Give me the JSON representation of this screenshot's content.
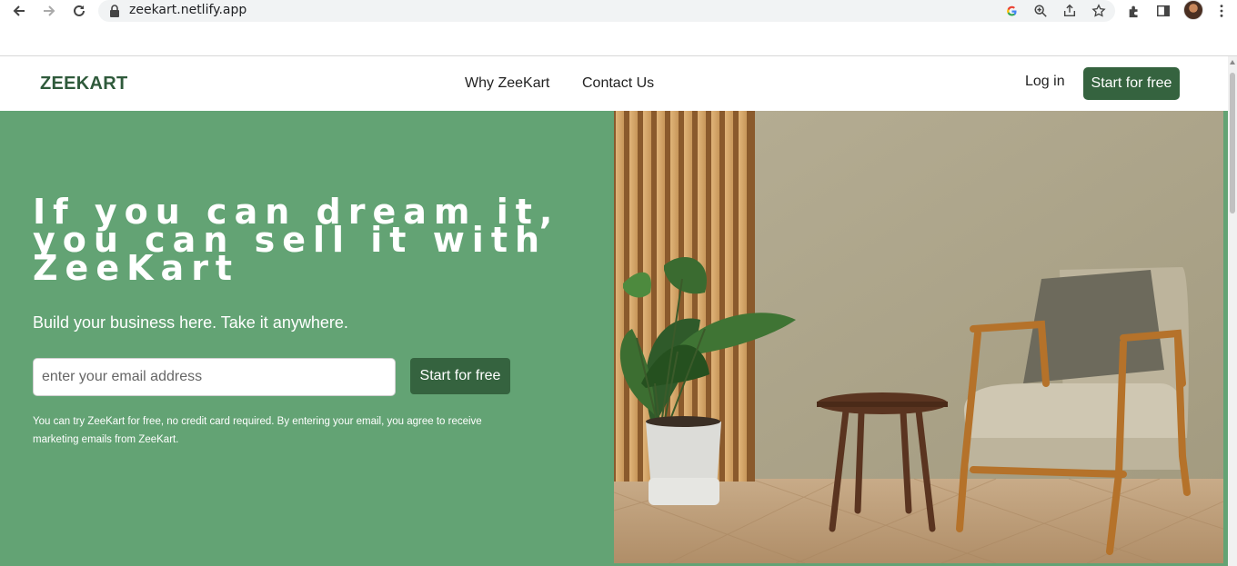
{
  "browser": {
    "url": "zeekart.netlify.app",
    "icons": [
      "back-icon",
      "forward-icon",
      "reload-icon",
      "lock-icon",
      "google-icon",
      "zoom-icon",
      "share-icon",
      "star-icon",
      "extensions-icon",
      "side-panel-icon",
      "profile-avatar",
      "menu-icon"
    ]
  },
  "header": {
    "logo": "ZEEKART",
    "nav": [
      "Why ZeeKart",
      "Contact Us"
    ],
    "login": "Log in",
    "cta": "Start for free"
  },
  "hero": {
    "headline_line1": "If you can dream it,",
    "headline_line2": "you can sell it with",
    "headline_line3": "ZeeKart",
    "subhead": "Build your business here. Take it anywhere.",
    "email_placeholder": "enter your email address",
    "cta": "Start for free",
    "disclaimer_line1": "You can try ZeeKart for free, no credit card required. By entering your email, you agree to receive",
    "disclaimer_line2": "marketing emails from ZeeKart."
  },
  "colors": {
    "hero_bg": "#63a374",
    "brand_dark": "#35633f",
    "logo": "#2f5a3b"
  }
}
